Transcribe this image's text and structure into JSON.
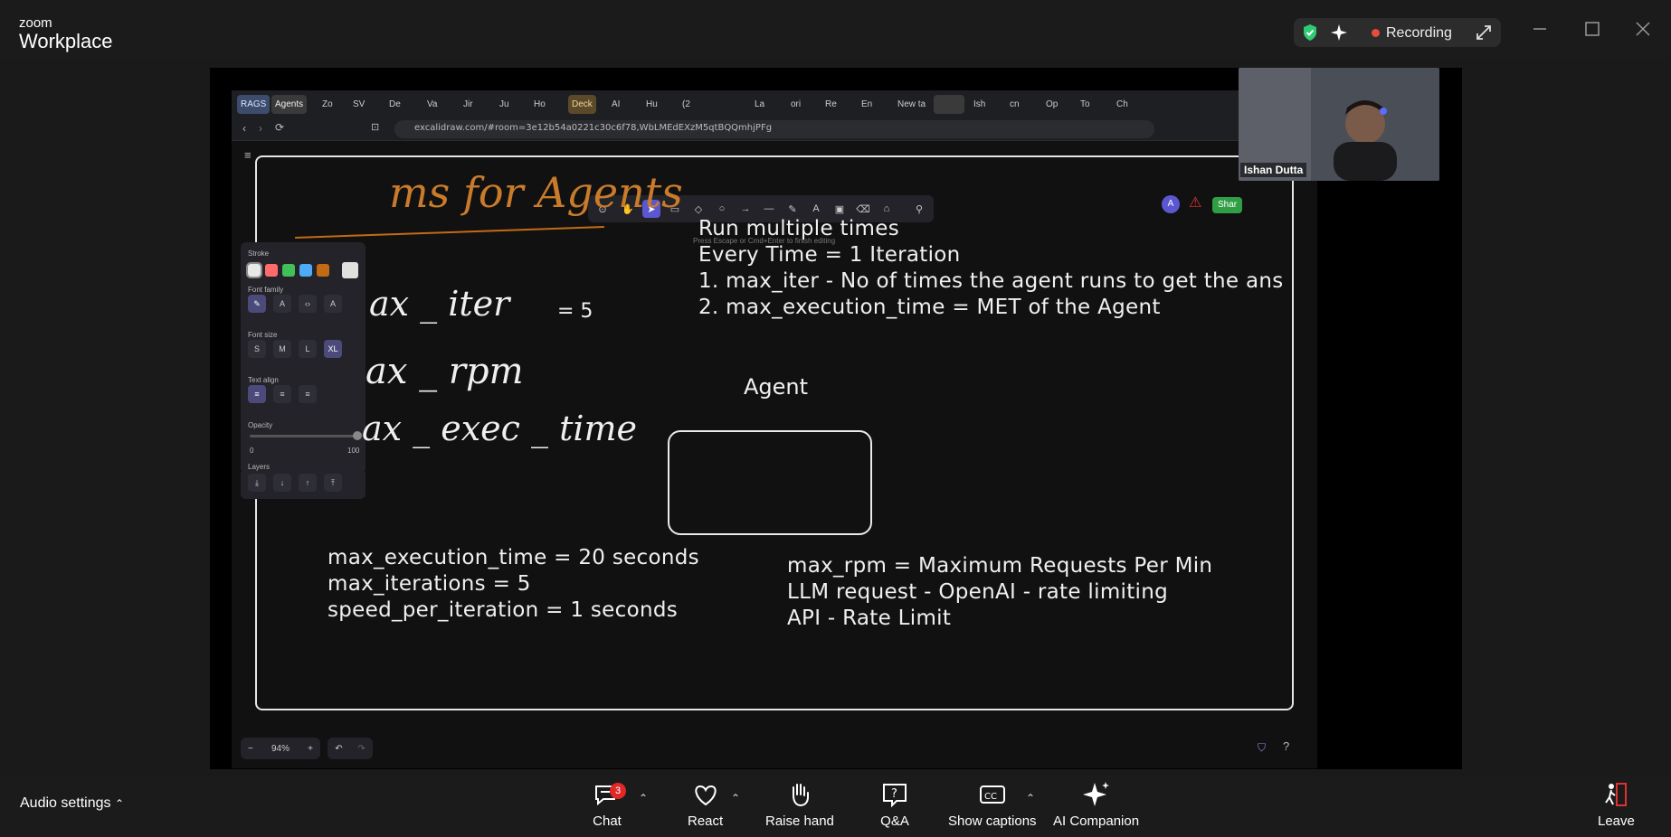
{
  "zoom": {
    "brand_top": "zoom",
    "brand_bottom": "Workplace",
    "recording_label": "Recording"
  },
  "browser": {
    "tabs": [
      "RAGS",
      "Agents",
      "Zo",
      "SV",
      "De",
      "Va",
      "Jir",
      "Ju",
      "Ho",
      "Deck",
      "AI",
      "Hu",
      "(2",
      "",
      "La",
      "ori",
      "Re",
      "En",
      "New ta",
      "",
      "Ish",
      "cn",
      "Op",
      "To",
      "Ch"
    ],
    "url": "excalidraw.com/#room=3e12b54a0221c30c6f78,WbLMEdEXzM5qtBQQmhjPFg"
  },
  "excalidraw": {
    "hint": "Press Escape or Cmd+Enter to finish editing",
    "props": {
      "stroke_label": "Stroke",
      "font_family_label": "Font family",
      "font_size_label": "Font size",
      "font_sizes": [
        "S",
        "M",
        "L",
        "XL"
      ],
      "text_align_label": "Text align",
      "opacity_label": "Opacity",
      "opacity_min": "0",
      "opacity_max": "100",
      "layers_label": "Layers",
      "stroke_colors": [
        "#e8e8e8",
        "#ff6b6b",
        "#40c057",
        "#4dabf7",
        "#c26b13",
        "#e0e0e0"
      ]
    },
    "zoom_level": "94%",
    "zoom_minus": "−",
    "zoom_plus": "+",
    "share_label": "Shar",
    "avatar_letter": "A"
  },
  "canvas": {
    "title_handwritten": "ms for Agents",
    "handwritten_params": [
      {
        "text": "ax _ iter",
        "suffix": "= 5"
      },
      {
        "text": "ax _ rpm",
        "suffix": ""
      },
      {
        "text": "ax _ exec _ time",
        "suffix": ""
      }
    ],
    "run_notes": [
      "Run multiple times",
      "Every Time = 1 Iteration",
      "1. max_iter - No of times the agent runs to get the ans",
      "2. max_execution_time = MET of the Agent"
    ],
    "agent_label": "Agent",
    "exec_notes": [
      "max_execution_time = 20 seconds",
      "max_iterations = 5",
      "speed_per_iteration = 1 seconds"
    ],
    "rpm_notes": [
      "max_rpm = Maximum Requests Per Min",
      "LLM request - OpenAI - rate limiting",
      "API - Rate Limit"
    ]
  },
  "video": {
    "participant_name": "Ishan Dutta"
  },
  "controls": {
    "audio_settings": "Audio settings",
    "chat": "Chat",
    "chat_badge": "3",
    "react": "React",
    "raise_hand": "Raise hand",
    "qa": "Q&A",
    "show_captions": "Show captions",
    "ai_companion": "AI Companion",
    "leave": "Leave"
  }
}
